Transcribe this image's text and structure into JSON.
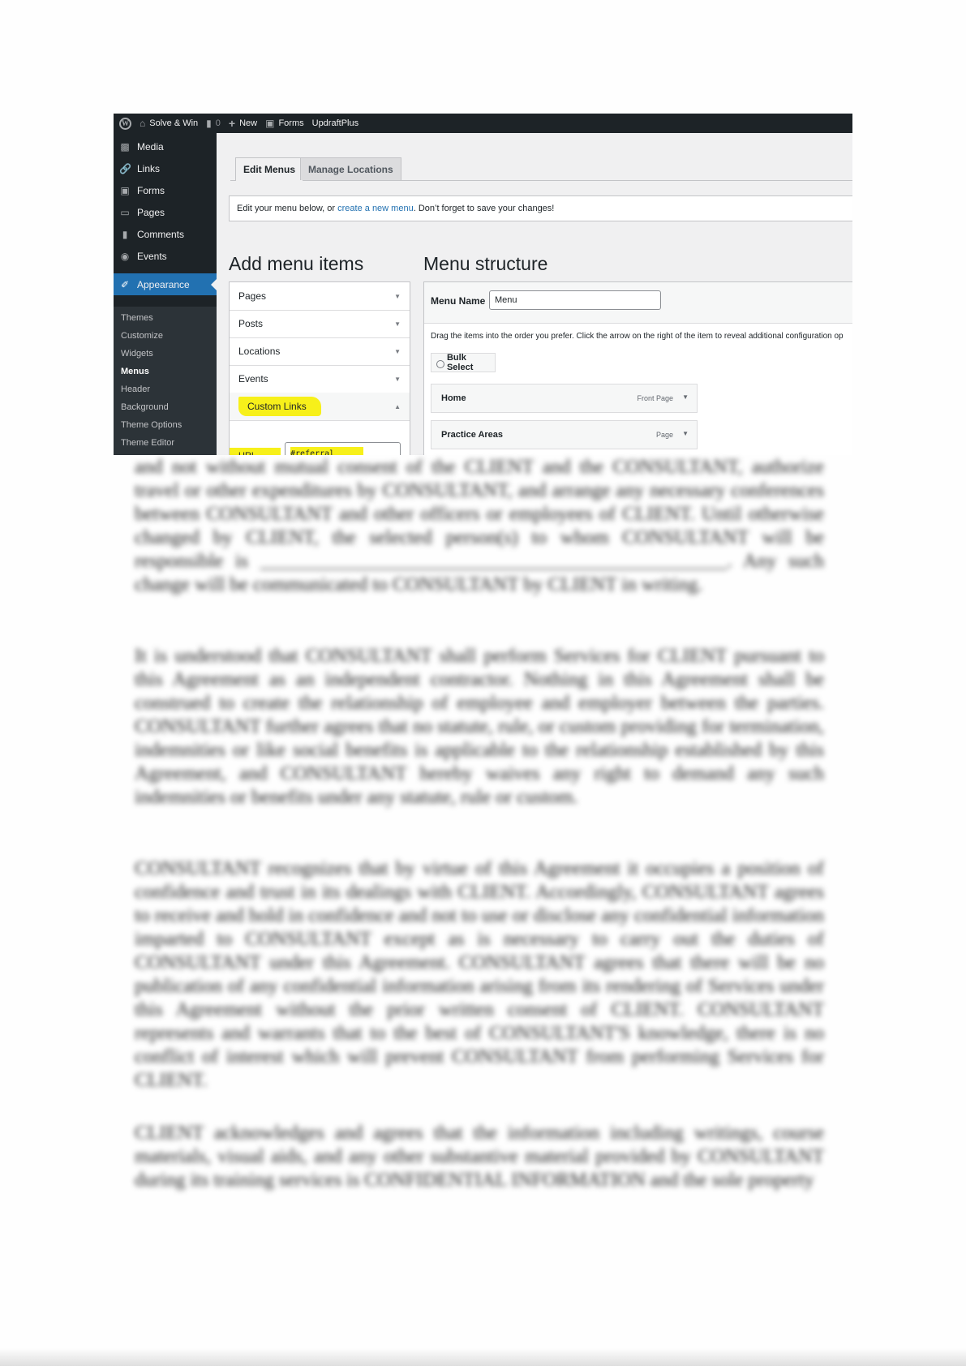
{
  "admin_bar": {
    "site_name": "Solve & Win",
    "comments_count": "0",
    "new_label": "New",
    "forms_label": "Forms",
    "updraft_label": "UpdraftPlus",
    "icons": [
      "wordpress-logo-icon",
      "home-icon",
      "comment-icon",
      "plus-icon",
      "forms-icon"
    ]
  },
  "sidebar": {
    "items": [
      {
        "label": "Media",
        "icon": "media-icon"
      },
      {
        "label": "Links",
        "icon": "link-icon"
      },
      {
        "label": "Forms",
        "icon": "forms-icon"
      },
      {
        "label": "Pages",
        "icon": "pages-icon"
      },
      {
        "label": "Comments",
        "icon": "comments-icon"
      },
      {
        "label": "Events",
        "icon": "events-icon"
      },
      {
        "label": "Appearance",
        "icon": "paintbrush-icon",
        "active": true
      }
    ],
    "submenu": [
      {
        "label": "Themes"
      },
      {
        "label": "Customize"
      },
      {
        "label": "Widgets"
      },
      {
        "label": "Menus",
        "current": true
      },
      {
        "label": "Header"
      },
      {
        "label": "Background"
      },
      {
        "label": "Theme Options"
      },
      {
        "label": "Theme Editor"
      }
    ]
  },
  "tabs": {
    "edit_menus": "Edit Menus",
    "manage_locations": "Manage Locations"
  },
  "notice": {
    "prefix": "Edit your menu below, or ",
    "link": "create a new menu",
    "suffix": ". Don’t forget to save your changes!"
  },
  "add_menu_items": {
    "heading": "Add menu items",
    "sections": [
      {
        "label": "Pages",
        "state": "collapsed"
      },
      {
        "label": "Posts",
        "state": "collapsed"
      },
      {
        "label": "Locations",
        "state": "collapsed"
      },
      {
        "label": "Events",
        "state": "collapsed"
      },
      {
        "label": "Custom Links",
        "state": "expanded",
        "highlighted": true
      }
    ],
    "url_label": "URL",
    "url_value": "#referral"
  },
  "menu_structure": {
    "heading": "Menu structure",
    "menu_name_label": "Menu Name",
    "menu_name_value": "Menu",
    "drag_help": "Drag the items into the order you prefer. Click the arrow on the right of the item to reveal additional configuration op",
    "bulk_select_label": "Bulk Select",
    "items": [
      {
        "title": "Home",
        "type": "Front Page"
      },
      {
        "title": "Practice Areas",
        "type": "Page"
      }
    ]
  },
  "colors": {
    "admin_dark": "#1d2327",
    "accent_blue": "#2271b1",
    "highlight_yellow": "#f7f01a"
  },
  "document": {
    "note": "blurred body text (illegible)",
    "paragraphs": [
      "and not without mutual consent of the CLIENT and the CONSULTANT, authorize travel or other expenditures by CONSULTANT, and arrange any necessary conferences between CONSULTANT and other officers or employees of CLIENT. Until otherwise changed by CLIENT, the selected person(s) to whom CONSULTANT will be responsible is ________________________________________________. Any such change will be communicated to CONSULTANT by CLIENT in writing.",
      "It is understood that CONSULTANT shall perform Services for CLIENT pursuant to this Agreement as an independent contractor. Nothing in this Agreement shall be construed to create the relationship of employee and employer between the parties. CONSULTANT further agrees that no statute, rule, or custom providing for termination, indemnities or like social benefits is applicable to the relationship established by this Agreement, and CONSULTANT hereby waives any right to demand any such indemnities or benefits under any statute, rule or custom.",
      "CONSULTANT recognizes that by virtue of this Agreement it occupies a position of confidence and trust in its dealings with CLIENT. Accordingly, CONSULTANT agrees to receive and hold in confidence and not to use or disclose any confidential information imparted to CONSULTANT except as is necessary to carry out the duties of CONSULTANT under this Agreement. CONSULTANT agrees that there will be no publication of any confidential information arising from its rendering of Services under this Agreement without the prior written consent of CLIENT. CONSULTANT represents and warrants that to the best of CONSULTANT'S knowledge, there is no conflict of interest which will prevent CONSULTANT from performing Services for CLIENT.",
      "CLIENT acknowledges and agrees that the information including writings, course materials, visual aids, and any other substantive material provided by CONSULTANT during its training services is CONFIDENTIAL INFORMATION and the sole property"
    ]
  }
}
